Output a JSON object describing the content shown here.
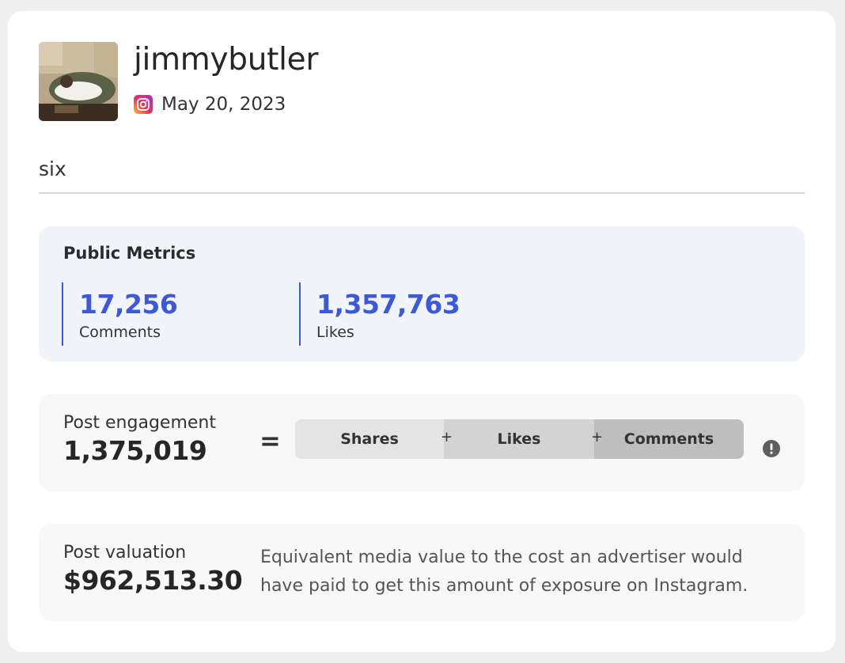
{
  "post": {
    "username": "jimmybutler",
    "platform_icon": "instagram-icon",
    "date": "May 20, 2023",
    "caption": "six"
  },
  "metrics": {
    "title": "Public Metrics",
    "comments_value": "17,256",
    "comments_label": "Comments",
    "likes_value": "1,357,763",
    "likes_label": "Likes",
    "accent_color": "#3d59d6"
  },
  "engagement": {
    "label": "Post engagement",
    "value": "1,375,019",
    "equals": "=",
    "shares_label": "Shares",
    "likes_label": "Likes",
    "comments_label": "Comments",
    "plus": "+",
    "info_icon": "alert-icon"
  },
  "valuation": {
    "label": "Post valuation",
    "value": "$962,513.30",
    "description": "Equivalent media value to the cost an advertiser would have paid to get this amount of exposure on Instagram."
  }
}
